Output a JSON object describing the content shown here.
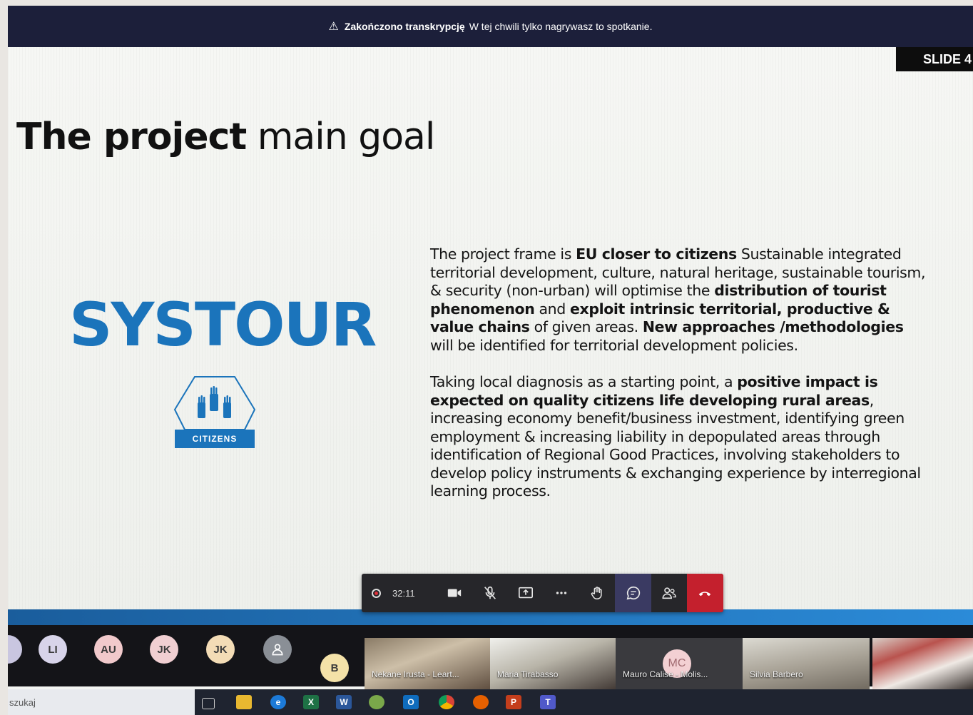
{
  "notification": {
    "bold": "Zakończono transkrypcję",
    "text": "W tej chwili tylko nagrywasz to spotkanie."
  },
  "slide": {
    "badge": "SLIDE 4",
    "title_bold": "The project",
    "title_rest": " main goal",
    "logo": "SYSTOUR",
    "badge_label": "CITIZENS",
    "p1": [
      {
        "t": "The project frame is ",
        "b": false
      },
      {
        "t": "EU closer to citizens",
        "b": true
      },
      {
        "t": " Sustainable integrated territorial development, culture, natural heritage, sustainable tourism, & security (non-urban) will optimise the ",
        "b": false
      },
      {
        "t": "distribution of tourist phenomenon",
        "b": true
      },
      {
        "t": " and ",
        "b": false
      },
      {
        "t": "exploit intrinsic territorial, productive & value chains",
        "b": true
      },
      {
        "t": " of given areas. ",
        "b": false
      },
      {
        "t": "New approaches /methodologies",
        "b": true
      },
      {
        "t": " will be identified for territorial development policies.",
        "b": false
      }
    ],
    "p2": [
      {
        "t": "Taking local diagnosis as a starting point, a ",
        "b": false
      },
      {
        "t": "positive impact is expected on quality citizens life developing rural areas",
        "b": true
      },
      {
        "t": ", increasing economy benefit/business investment, identifying green employment & increasing liability in depopulated areas through identification of Regional Good Practices, involving stakeholders to develop policy instruments & exchanging experience by interregional learning process.",
        "b": false
      }
    ]
  },
  "toolbar": {
    "timer": "32:11",
    "icons": [
      "camera-icon",
      "mic-muted-icon",
      "share-screen-icon",
      "more-icon",
      "raise-hand-icon",
      "chat-icon",
      "people-icon",
      "hang-up-icon"
    ]
  },
  "participants": {
    "avatars": [
      {
        "initials": "LI",
        "color": "#d8d4ea"
      },
      {
        "initials": "AU",
        "color": "#f1c9cb"
      },
      {
        "initials": "JK",
        "color": "#f1cfd2"
      },
      {
        "initials": "JK",
        "color": "#f3dcb6"
      },
      {
        "initials": "",
        "color": "#8a8f96"
      },
      {
        "initials": "B",
        "color": "#f4e2a8"
      }
    ],
    "tiles": [
      {
        "name": "Nekane Irusta - Leart..."
      },
      {
        "name": "Maria Tirabasso"
      },
      {
        "name": "Mauro Calise - Molis...",
        "initials": "MC"
      },
      {
        "name": "Silvia Barbero"
      },
      {
        "name": ""
      }
    ]
  },
  "taskbar": {
    "search_placeholder": "szukaj",
    "apps": [
      "task-view-icon",
      "file-explorer-icon",
      "edge-icon",
      "excel-icon",
      "word-icon",
      "app-icon",
      "outlook-icon",
      "chrome-icon",
      "firefox-icon",
      "powerpoint-icon",
      "teams-icon"
    ]
  },
  "colors": {
    "accent_blue": "#1b74bb",
    "notice_bg": "#1c1f3a",
    "hangup_red": "#c4202d",
    "toolbar_bg": "#26262a"
  }
}
